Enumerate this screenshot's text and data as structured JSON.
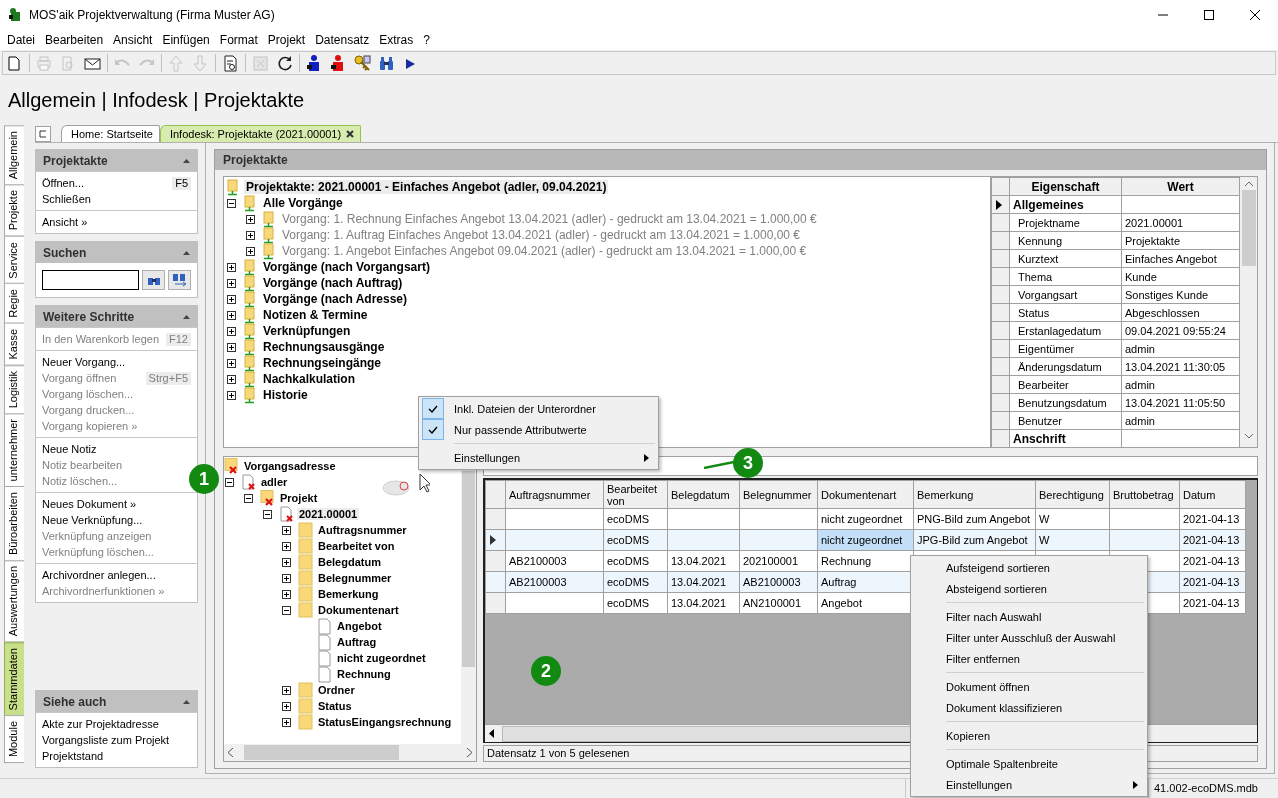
{
  "window": {
    "title": "MOS'aik Projektverwaltung (Firma Muster AG)"
  },
  "menu_bar": [
    "Datei",
    "Bearbeiten",
    "Ansicht",
    "Einfügen",
    "Format",
    "Projekt",
    "Datensatz",
    "Extras",
    "?"
  ],
  "toolbar": [
    {
      "kind": "new",
      "disabled": false
    },
    {
      "kind": "separator"
    },
    {
      "kind": "print",
      "disabled": true
    },
    {
      "kind": "preview",
      "disabled": true
    },
    {
      "kind": "mail",
      "disabled": false
    },
    {
      "kind": "separator"
    },
    {
      "kind": "undo",
      "disabled": true
    },
    {
      "kind": "redo",
      "disabled": true
    },
    {
      "kind": "separator"
    },
    {
      "kind": "up",
      "disabled": true
    },
    {
      "kind": "down",
      "disabled": true
    },
    {
      "kind": "separator"
    },
    {
      "kind": "report",
      "disabled": false
    },
    {
      "kind": "separator"
    },
    {
      "kind": "excel",
      "disabled": true
    },
    {
      "kind": "refresh",
      "disabled": false
    },
    {
      "kind": "separator"
    },
    {
      "kind": "personblue",
      "disabled": false
    },
    {
      "kind": "personred",
      "disabled": false
    },
    {
      "kind": "keys",
      "disabled": false
    },
    {
      "kind": "binoculars",
      "disabled": false
    },
    {
      "kind": "play",
      "disabled": false
    }
  ],
  "breadcrumb": "Allgemein | Infodesk | Projektakte",
  "side_tabs": [
    {
      "label": "Allgemein",
      "selected": false
    },
    {
      "label": "Projekte",
      "selected": false
    },
    {
      "label": "Service",
      "selected": false
    },
    {
      "label": "Regie",
      "selected": false
    },
    {
      "label": "Kasse",
      "selected": false
    },
    {
      "label": "Logistik",
      "selected": false
    },
    {
      "label": "unternehmer",
      "selected": false
    },
    {
      "label": "Büroarbeiten",
      "selected": false
    },
    {
      "label": "Auswertungen",
      "selected": false
    },
    {
      "label": "Stammdaten",
      "selected": true
    },
    {
      "label": "Module",
      "selected": false
    }
  ],
  "doc_tabs": [
    {
      "label": "Home: Startseite",
      "selected": false,
      "closable": false
    },
    {
      "label": "Infodesk: Projektakte (2021.00001)",
      "selected": true,
      "closable": true
    }
  ],
  "task_pane": [
    {
      "title": "Projektakte",
      "kind": "links",
      "groups": [
        [
          {
            "label": "Öffnen...",
            "disabled": false,
            "shortcut": "F5"
          },
          {
            "label": "Schließen",
            "disabled": false
          }
        ],
        [
          {
            "label": "Ansicht »",
            "disabled": false
          }
        ]
      ]
    },
    {
      "title": "Suchen",
      "kind": "search"
    },
    {
      "title": "Weitere Schritte",
      "kind": "links",
      "groups": [
        [
          {
            "label": "In den Warenkorb legen",
            "disabled": true,
            "shortcut": "F12"
          }
        ],
        [
          {
            "label": "Neuer Vorgang...",
            "disabled": false
          },
          {
            "label": "Vorgang öffnen",
            "disabled": true,
            "shortcut": "Strg+F5"
          },
          {
            "label": "Vorgang löschen...",
            "disabled": true
          },
          {
            "label": "Vorgang drucken...",
            "disabled": true
          },
          {
            "label": "Vorgang kopieren »",
            "disabled": true
          }
        ],
        [
          {
            "label": "Neue Notiz",
            "disabled": false
          },
          {
            "label": "Notiz bearbeiten",
            "disabled": true
          },
          {
            "label": "Notiz löschen...",
            "disabled": true
          }
        ],
        [
          {
            "label": "Neues Dokument »",
            "disabled": false
          },
          {
            "label": "Neue Verknüpfung...",
            "disabled": false
          },
          {
            "label": "Verknüpfung anzeigen",
            "disabled": true
          },
          {
            "label": "Verknüpfung löschen...",
            "disabled": true
          }
        ],
        [
          {
            "label": "Archivordner anlegen...",
            "disabled": false
          },
          {
            "label": "Archivordnerfunktionen »",
            "disabled": true
          }
        ]
      ]
    },
    {
      "title": "Siehe auch",
      "kind": "links",
      "groups": [
        [
          {
            "label": "Akte zur Projektadresse",
            "disabled": false
          },
          {
            "label": "Vorgangsliste zum Projekt",
            "disabled": false
          },
          {
            "label": "Projektstand",
            "disabled": false
          }
        ]
      ]
    }
  ],
  "panel": {
    "title": "Projektakte",
    "tree": [
      {
        "label": "Projektakte: 2021.00001 - Einfaches Angebot (adler, 09.04.2021)",
        "kind": "node",
        "selected": true,
        "dimmed": false,
        "children": [
          {
            "label": "Alle Vorgänge",
            "kind": "node",
            "expanded": true,
            "selected": false,
            "dimmed": false,
            "children": [
              {
                "label": "Vorgang: 1. Rechnung Einfaches Angebot 13.04.2021 (adler) - gedruckt am 13.04.2021 = 1.000,00 €",
                "kind": "node",
                "expanded": false,
                "selected": false,
                "dimmed": true
              },
              {
                "label": "Vorgang: 1. Auftrag Einfaches Angebot 13.04.2021 (adler) - gedruckt am 13.04.2021 = 1.000,00 €",
                "kind": "node",
                "expanded": false,
                "selected": false,
                "dimmed": true
              },
              {
                "label": "Vorgang: 1. Angebot Einfaches Angebot 09.04.2021 (adler) - gedruckt am 13.04.2021 = 1.000,00 €",
                "kind": "node",
                "expanded": false,
                "selected": false,
                "dimmed": true
              }
            ]
          },
          {
            "label": "Vorgänge (nach Vorgangsart)",
            "kind": "node",
            "expanded": false,
            "selected": false,
            "dimmed": false
          },
          {
            "label": "Vorgänge (nach Auftrag)",
            "kind": "node",
            "expanded": false,
            "selected": false,
            "dimmed": false
          },
          {
            "label": "Vorgänge (nach Adresse)",
            "kind": "node",
            "expanded": false,
            "selected": false,
            "dimmed": false
          },
          {
            "label": "Notizen & Termine",
            "kind": "node",
            "expanded": false,
            "selected": false,
            "dimmed": false
          },
          {
            "label": "Verknüpfungen",
            "kind": "node",
            "expanded": false,
            "selected": false,
            "dimmed": false
          },
          {
            "label": "Rechnungsausgänge",
            "kind": "node",
            "expanded": false,
            "selected": false,
            "dimmed": false
          },
          {
            "label": "Rechnungseingänge",
            "kind": "node",
            "expanded": false,
            "selected": false,
            "dimmed": false
          },
          {
            "label": "Nachkalkulation",
            "kind": "node",
            "expanded": false,
            "selected": false,
            "dimmed": false
          },
          {
            "label": "Historie",
            "kind": "node",
            "expanded": false,
            "selected": false,
            "dimmed": false
          }
        ]
      }
    ],
    "properties": {
      "columns": [
        "Eigenschaft",
        "Wert"
      ],
      "rows": [
        {
          "kind": "category",
          "name": "Allgemeines",
          "selected": true
        },
        {
          "kind": "property",
          "name": "Projektname",
          "value": "2021.00001",
          "selected": false
        },
        {
          "kind": "property",
          "name": "Kennung",
          "value": "Projektakte",
          "selected": false
        },
        {
          "kind": "property",
          "name": "Kurztext",
          "value": "Einfaches Angebot",
          "selected": false
        },
        {
          "kind": "property",
          "name": "Thema",
          "value": "Kunde",
          "selected": false
        },
        {
          "kind": "property",
          "name": "Vorgangsart",
          "value": "Sonstiges Kunde",
          "selected": false
        },
        {
          "kind": "property",
          "name": "Status",
          "value": "Abgeschlossen",
          "selected": false
        },
        {
          "kind": "property",
          "name": "Erstanlagedatum",
          "value": "09.04.2021 09:55:24",
          "selected": false
        },
        {
          "kind": "property",
          "name": "Eigentümer",
          "value": "admin",
          "selected": false
        },
        {
          "kind": "property",
          "name": "Änderungsdatum",
          "value": "13.04.2021 11:30:05",
          "selected": false
        },
        {
          "kind": "property",
          "name": "Bearbeiter",
          "value": "admin",
          "selected": false
        },
        {
          "kind": "property",
          "name": "Benutzungsdatum",
          "value": "13.04.2021 11:05:50",
          "selected": false
        },
        {
          "kind": "property",
          "name": "Benutzer",
          "value": "admin",
          "selected": false
        },
        {
          "kind": "category",
          "name": "Anschrift",
          "selected": false
        }
      ]
    },
    "doc_tree": [
      {
        "label": "Vorgangsadresse",
        "kind": "xfolder",
        "selected": false,
        "children": [
          {
            "label": "adler",
            "kind": "xdoc",
            "expanded": true,
            "selected": false,
            "children": [
              {
                "label": "Projekt",
                "kind": "xfolder",
                "expanded": true,
                "selected": false,
                "children": [
                  {
                    "label": "2021.00001",
                    "kind": "xdoc",
                    "expanded": true,
                    "selected": true,
                    "children": [
                      {
                        "label": "Auftragsnummer",
                        "kind": "folder",
                        "expanded": false,
                        "selected": false
                      },
                      {
                        "label": "Bearbeitet von",
                        "kind": "folder",
                        "expanded": false,
                        "selected": false
                      },
                      {
                        "label": "Belegdatum",
                        "kind": "folder",
                        "expanded": false,
                        "selected": false
                      },
                      {
                        "label": "Belegnummer",
                        "kind": "folder",
                        "expanded": false,
                        "selected": false
                      },
                      {
                        "label": "Bemerkung",
                        "kind": "folder",
                        "expanded": false,
                        "selected": false
                      },
                      {
                        "label": "Dokumentenart",
                        "kind": "folder",
                        "expanded": true,
                        "selected": false,
                        "children": [
                          {
                            "label": "Angebot",
                            "kind": "doc",
                            "selected": false
                          },
                          {
                            "label": "Auftrag",
                            "kind": "doc",
                            "selected": false
                          },
                          {
                            "label": "nicht zugeordnet",
                            "kind": "doc",
                            "selected": false
                          },
                          {
                            "label": "Rechnung",
                            "kind": "doc",
                            "selected": false
                          }
                        ]
                      },
                      {
                        "label": "Ordner",
                        "kind": "folder",
                        "expanded": false,
                        "selected": false
                      },
                      {
                        "label": "Status",
                        "kind": "folder",
                        "expanded": false,
                        "selected": false
                      },
                      {
                        "label": "StatusEingangsrechnung",
                        "kind": "folder",
                        "expanded": false,
                        "selected": false
                      }
                    ]
                  }
                ]
              }
            ]
          }
        ]
      }
    ],
    "grid": {
      "columns": [
        "Auftragsnummer",
        "Bearbeitet von",
        "Belegdatum",
        "Belegnummer",
        "Dokumentenart",
        "Bemerkung",
        "Berechtigung",
        "Bruttobetrag",
        "Datum"
      ],
      "rows": [
        {
          "selected": false,
          "cells": [
            null,
            "ecoDMS",
            null,
            null,
            "nicht zugeordnet",
            "PNG-Bild zum Angebot",
            "W",
            null,
            "2021-04-13"
          ]
        },
        {
          "selected": true,
          "cells": [
            null,
            "ecoDMS",
            null,
            null,
            {
              "text": "nicht zugeordnet",
              "focused": true
            },
            "JPG-Bild zum Angebot",
            "W",
            null,
            "2021-04-13"
          ]
        },
        {
          "selected": false,
          "cells": [
            "AB2100003",
            "ecoDMS",
            "13.04.2021",
            "202100001",
            "Rechnung",
            null,
            null,
            null,
            "2021-04-13"
          ]
        },
        {
          "selected": false,
          "cells": [
            "AB2100003",
            "ecoDMS",
            "13.04.2021",
            "AB2100003",
            "Auftrag",
            null,
            null,
            null,
            "2021-04-13"
          ]
        },
        {
          "selected": false,
          "cells": [
            null,
            "ecoDMS",
            "13.04.2021",
            "AN2100001",
            "Angebot",
            null,
            null,
            null,
            "2021-04-13"
          ]
        }
      ],
      "status": "Datensatz 1 von 5 gelesenen"
    }
  },
  "context_menus": [
    {
      "items": [
        {
          "kind": "check",
          "label": "Inkl. Dateien der Unterordner",
          "checked": true
        },
        {
          "kind": "check",
          "label": "Nur passende Attributwerte",
          "checked": true
        },
        {
          "kind": "separator"
        },
        {
          "kind": "submenu",
          "label": "Einstellungen"
        }
      ]
    },
    {
      "items": [
        {
          "kind": "item",
          "label": "Aufsteigend sortieren"
        },
        {
          "kind": "item",
          "label": "Absteigend sortieren"
        },
        {
          "kind": "separator"
        },
        {
          "kind": "item",
          "label": "Filter nach Auswahl"
        },
        {
          "kind": "item",
          "label": "Filter unter Ausschluß der Auswahl"
        },
        {
          "kind": "item",
          "label": "Filter entfernen"
        },
        {
          "kind": "separator"
        },
        {
          "kind": "item",
          "label": "Dokument öffnen"
        },
        {
          "kind": "item",
          "label": "Dokument klassifizieren"
        },
        {
          "kind": "separator"
        },
        {
          "kind": "item",
          "label": "Kopieren"
        },
        {
          "kind": "separator"
        },
        {
          "kind": "item",
          "label": "Optimale Spaltenbreite"
        },
        {
          "kind": "submenu",
          "label": "Einstellungen"
        }
      ]
    }
  ],
  "callouts": [
    "1",
    "2",
    "3"
  ],
  "status_bar": {
    "file": "41.002-ecoDMS.mdb"
  }
}
